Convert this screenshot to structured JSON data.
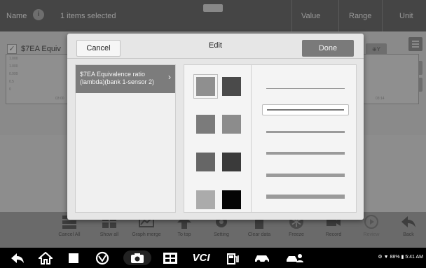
{
  "header": {
    "name_label": "Name",
    "selected_text": "1 items selected",
    "value_label": "Value",
    "range_label": "Range",
    "unit_label": "Unit"
  },
  "row": {
    "title": "$7EA Equiv",
    "zoom_label": "Y",
    "x_label_left": "03:00",
    "x_label_right": "03:14",
    "y_ticks": [
      "1.000",
      "1.000",
      "0.999",
      "0.5",
      "0"
    ]
  },
  "modal": {
    "title": "Edit",
    "cancel_label": "Cancel",
    "done_label": "Done",
    "pid_items": [
      {
        "label": "$7EA Equivalence ratio (lambda)(bank 1-sensor 2)"
      }
    ],
    "selected_line": 1,
    "colors": [
      "#8f8f8f",
      "#4a4a4a",
      "#7b7b7b",
      "#8c8c8c",
      "#666666",
      "#3a3a3a",
      "#ababab",
      "#050505"
    ],
    "line_count": 6
  },
  "toolbar": {
    "items": [
      "Cancel All",
      "Show all",
      "Graph merge",
      "To top",
      "Setting",
      "Clear data",
      "Freeze",
      "Record",
      "Review",
      "Back"
    ]
  },
  "statusbar": {
    "battery": "88%",
    "time": "5:41 AM"
  }
}
